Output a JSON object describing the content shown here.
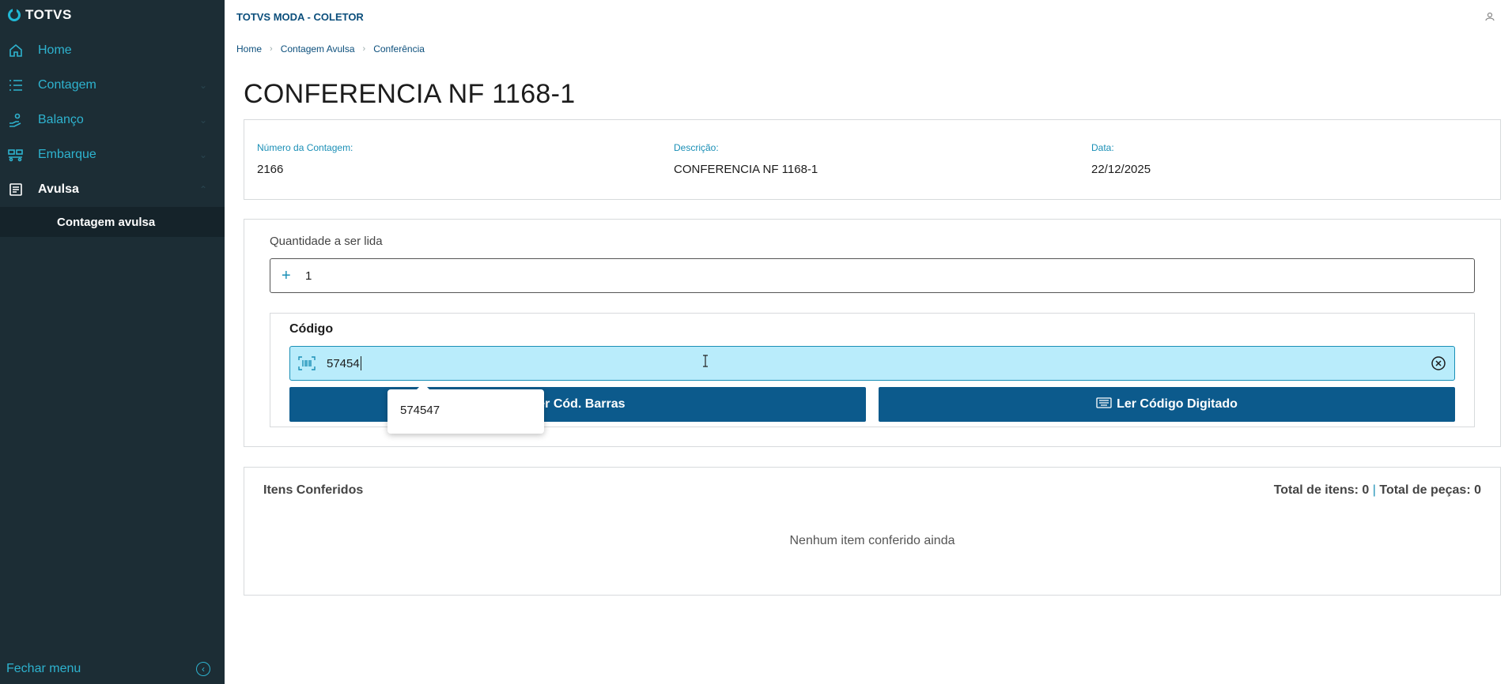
{
  "sidebar": {
    "logo": "TOTVS",
    "items": [
      {
        "label": "Home",
        "icon": "home-icon"
      },
      {
        "label": "Contagem",
        "icon": "list-icon"
      },
      {
        "label": "Balanço",
        "icon": "hand-icon"
      },
      {
        "label": "Embarque",
        "icon": "truck-icon"
      },
      {
        "label": "Avulsa",
        "icon": "document-icon"
      }
    ],
    "subitem": "Contagem avulsa",
    "close_menu": "Fechar menu"
  },
  "header": {
    "app_title": "TOTVS MODA - COLETOR"
  },
  "breadcrumb": [
    "Home",
    "Contagem Avulsa",
    "Conferência"
  ],
  "page": {
    "title": "CONFERENCIA NF 1168-1"
  },
  "info": {
    "numero_label": "Número da Contagem:",
    "numero_value": "2166",
    "descricao_label": "Descrição:",
    "descricao_value": "CONFERENCIA NF 1168-1",
    "data_label": "Data:",
    "data_value": "22/12/2025"
  },
  "form": {
    "quantidade_label": "Quantidade a ser lida",
    "quantidade_value": "1",
    "codigo_label": "Código",
    "codigo_value": "57454",
    "autocomplete_option": "574547",
    "btn_barras": "Ler Cód. Barras",
    "btn_digitado": "Ler Código Digitado"
  },
  "items": {
    "title": "Itens Conferidos",
    "total_itens": "Total de itens: 0",
    "separator": "|",
    "total_pecas": "Total de peças: 0",
    "empty": "Nenhum item conferido ainda"
  },
  "colors": {
    "sidebar_bg": "#1c2d35",
    "accent": "#2eb3cf",
    "primary_button": "#0c5a8c",
    "input_highlight": "#b9ecfb"
  }
}
